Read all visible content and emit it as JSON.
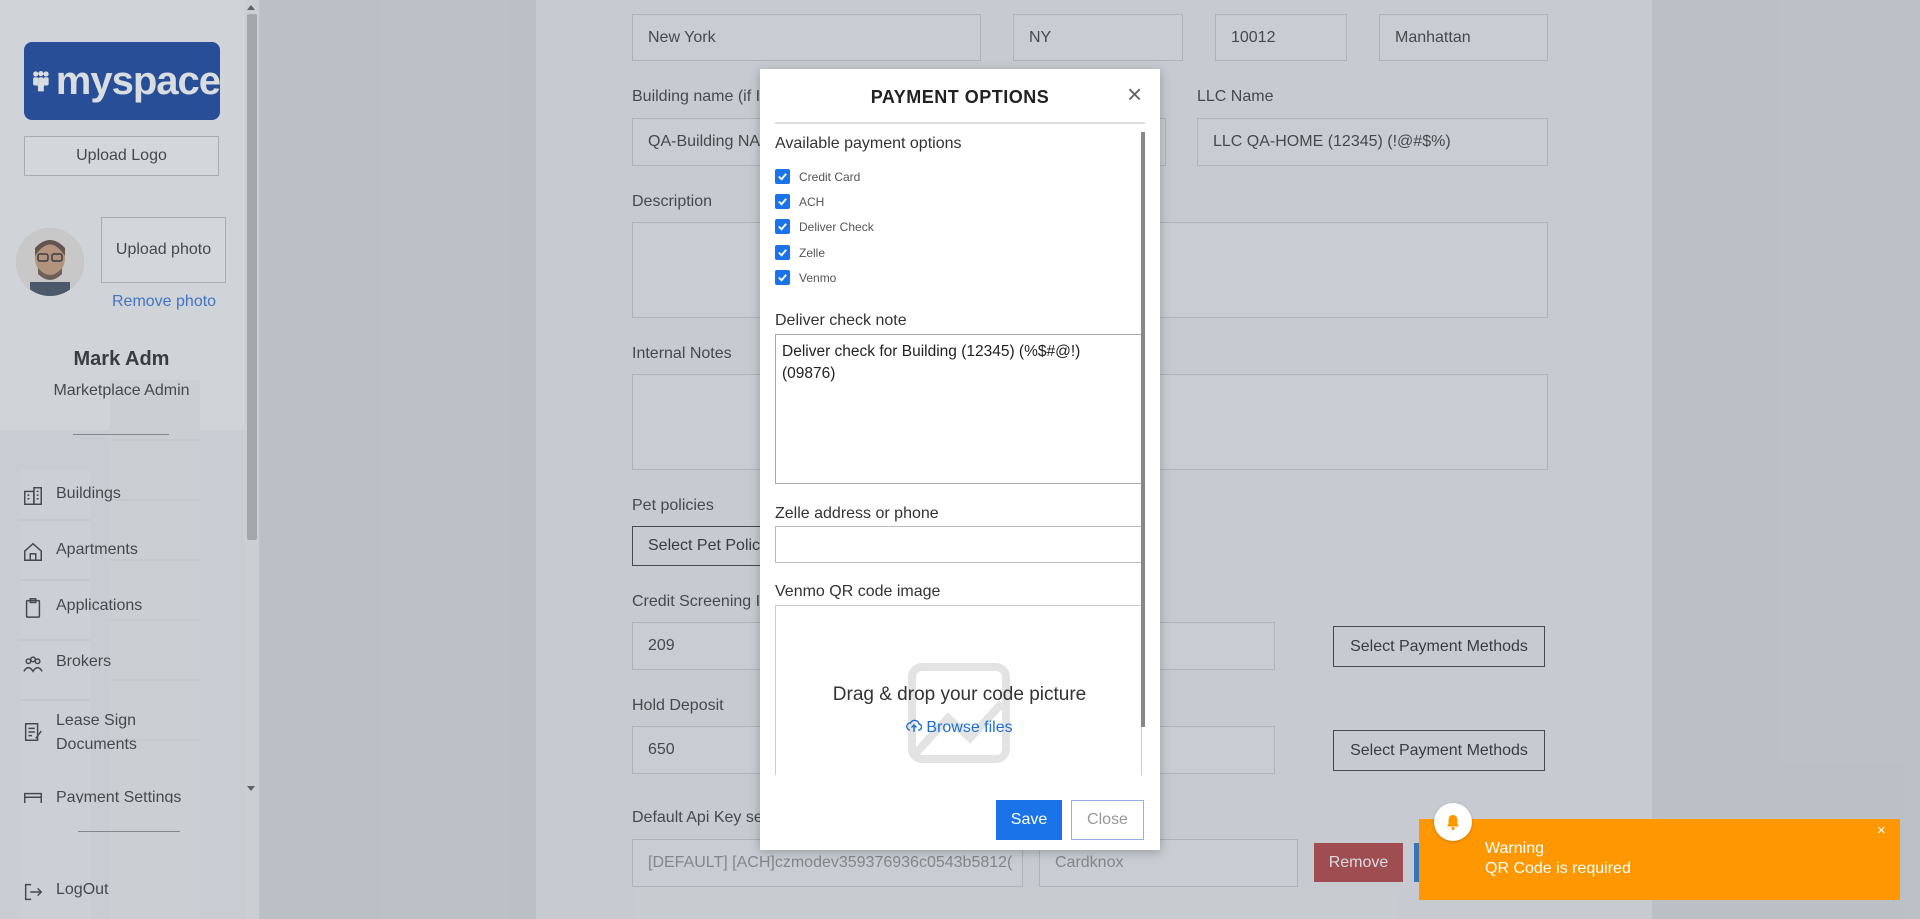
{
  "sidebar": {
    "logo_text": "myspace",
    "upload_logo": "Upload Logo",
    "upload_photo": "Upload photo",
    "remove_photo": "Remove photo",
    "user_name": "Mark Adm",
    "user_role": "Marketplace Admin",
    "nav": {
      "buildings": "Buildings",
      "apartments": "Apartments",
      "applications": "Applications",
      "brokers": "Brokers",
      "lease_sign": "Lease Sign Documents",
      "payment_settings": "Payment Settings",
      "logout": "LogOut"
    }
  },
  "form": {
    "city": "New York",
    "state": "NY",
    "zip": "10012",
    "neighborhood": "Manhattan",
    "building_name_label": "Building name (if I",
    "building_name_value": "QA-Building NA",
    "llc_label": "LLC Name",
    "llc_value": "LLC QA-HOME (12345) (!@#$%)",
    "description_label": "Description",
    "internal_notes_label": "Internal Notes",
    "pet_policies_label": "Pet policies",
    "pet_policies_button": "Select Pet Polic",
    "credit_screening_label": "Credit Screening I",
    "credit_screening_value": "209",
    "select_payment_methods_1": "Select Payment Methods",
    "hold_deposit_label": "Hold Deposit",
    "hold_deposit_value": "650",
    "select_payment_methods_2": "Select Payment Methods",
    "default_api_label": "Default Api Key se",
    "default_api_value": "[DEFAULT] [ACH]czmodev359376936c0543b5812(",
    "gateway_value": "Cardknox",
    "remove_button": "Remove"
  },
  "modal": {
    "title": "PAYMENT OPTIONS",
    "close_symbol": "×",
    "available_label": "Available payment options",
    "options": [
      "Credit Card",
      "ACH",
      "Deliver Check",
      "Zelle",
      "Venmo"
    ],
    "deliver_note_label": "Deliver check note",
    "deliver_note_value": "Deliver check for Building (12345) (%$#@!)\n(09876)",
    "zelle_label": "Zelle address or phone",
    "venmo_label": "Venmo QR code image",
    "dropzone_text": "Drag & drop your code picture",
    "browse_files": "Browse files",
    "save": "Save",
    "close": "Close"
  },
  "toast": {
    "title": "Warning",
    "message": "QR Code is required",
    "close_symbol": "×",
    "color": "#ff9800"
  }
}
